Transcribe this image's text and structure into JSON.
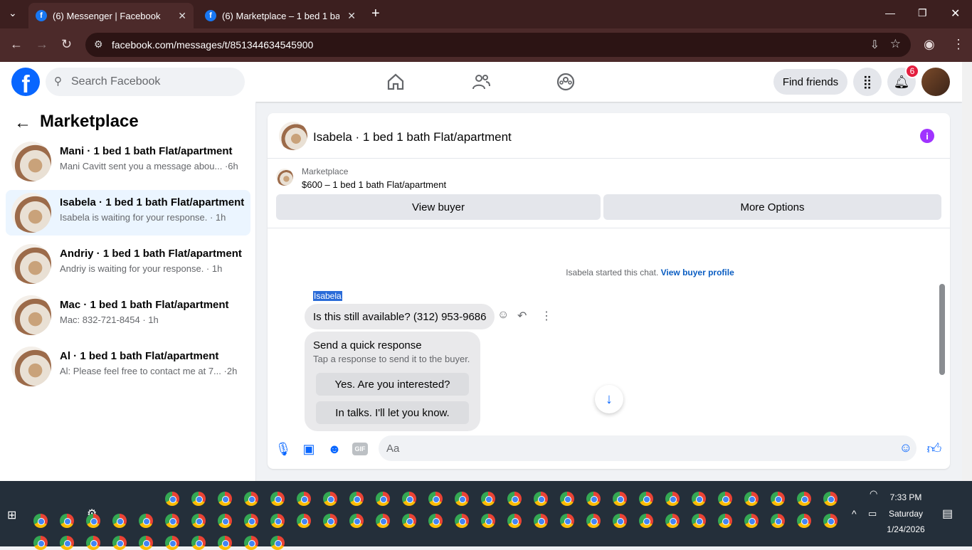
{
  "browser": {
    "tabs": [
      {
        "title": "(6) Messenger | Facebook"
      },
      {
        "title": "(6) Marketplace – 1 bed 1 bath"
      }
    ],
    "url": "facebook.com/messages/t/851344634545900"
  },
  "header": {
    "search_placeholder": "Search Facebook",
    "find_friends": "Find friends",
    "notif_count": "6"
  },
  "sidebar": {
    "title": "Marketplace",
    "conversations": [
      {
        "name": "Mani · 1 bed 1 bath Flat/apartment",
        "preview": "Mani Cavitt sent you a message abou... ·6h"
      },
      {
        "name": "Isabela · 1 bed 1 bath Flat/apartment",
        "preview": "Isabela is waiting for your response. · 1h"
      },
      {
        "name": "Andriy · 1 bed 1 bath Flat/apartment",
        "preview": "Andriy is waiting for your response. · 1h"
      },
      {
        "name": "Mac · 1 bed 1 bath Flat/apartment",
        "preview": "Mac: 832-721-8454 · 1h"
      },
      {
        "name": "Al · 1 bed 1 bath Flat/apartment",
        "preview": "Al: Please feel free to contact me at 7... ·2h"
      }
    ]
  },
  "chat": {
    "title": "Isabela · 1 bed 1 bath Flat/apartment",
    "marketplace_label": "Marketplace",
    "listing": "$600 – 1 bed 1 bath Flat/apartment",
    "view_buyer": "View buyer",
    "more_options": "More Options",
    "system_text": "Isabela started this chat.",
    "system_link": "View buyer profile",
    "sender": "Isabela",
    "message": "Is this still available? (312) 953-9686",
    "quick_title": "Send a quick response",
    "quick_sub": "Tap a response to send it to the buyer.",
    "quick_options": [
      "Yes. Are you interested?",
      "In talks. I'll let you know."
    ],
    "composer_placeholder": "Aa"
  },
  "taskbar": {
    "time": "7:33 PM",
    "day": "Saturday",
    "date": "1/24/2026"
  }
}
